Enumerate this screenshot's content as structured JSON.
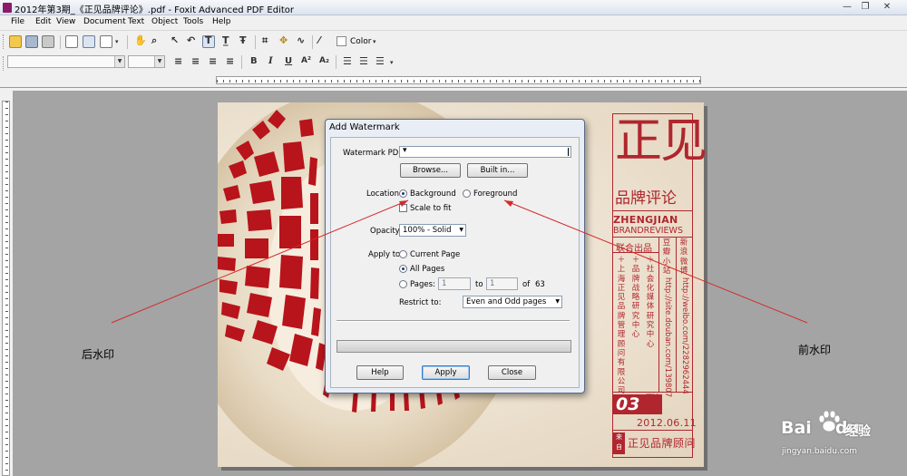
{
  "window": {
    "title": "2012年第3期_《正见品牌评论》.pdf - Foxit Advanced PDF Editor",
    "minimize": "—",
    "restore": "❐",
    "close": "✕"
  },
  "menu": [
    "File",
    "Edit",
    "View",
    "Document",
    "Text",
    "Object",
    "Tools",
    "Help"
  ],
  "toolbar": {
    "color_label": "Color",
    "bold": "B",
    "italic": "I",
    "underline": "U",
    "superscript": "A²",
    "subscript": "A₂"
  },
  "page": {
    "masthead_big": "正见",
    "masthead_sub": "品牌评论",
    "en1": "ZHENGJIAN",
    "en2": "BRANDREVIEWS",
    "lianhe": "联合出品",
    "col1": "＋上海正见品牌管理顾问有限公司",
    "col2": "＋品牌战略研究中心",
    "col3": "＋社会化媒体研究中心",
    "col4_head": "新浪微博",
    "col4_url": "http://weibo.com/2282962444",
    "col5_head": "豆瓣小站",
    "col5_url": "http://site.douban.com/139807",
    "issue": "03",
    "issue_suffix": "TH",
    "date": "2012.06.11",
    "foot_box": "来自",
    "foot": "正见品牌顾问"
  },
  "dialog": {
    "title": "Add Watermark",
    "watermark_pdf_label": "Watermark PDF:",
    "browse": "Browse...",
    "builtin": "Built in...",
    "location_label": "Location:",
    "background": "Background",
    "foreground": "Foreground",
    "scale_to_fit": "Scale to fit",
    "opacity_label": "Opacity:",
    "opacity_value": "100% - Solid",
    "apply_to_label": "Apply to:",
    "current_page": "Current Page",
    "all_pages": "All Pages",
    "pages_label": "Pages:",
    "pages_from": "1",
    "pages_to_label": "to",
    "pages_to": "1",
    "pages_of_label": "of",
    "pages_total": "63",
    "restrict_label": "Restrict to:",
    "restrict_value": "Even and Odd pages",
    "help": "Help",
    "apply": "Apply",
    "close": "Close"
  },
  "annotations": {
    "left": "后水印",
    "right": "前水印"
  },
  "brand_watermark": {
    "text": "Bai",
    "tail": "du",
    "cn": "经验",
    "url": "jingyan.baidu.com"
  },
  "colors": {
    "accent_red": "#b0262e",
    "arrow_red": "#d42a2a",
    "workspace": "#a4a4a4"
  }
}
